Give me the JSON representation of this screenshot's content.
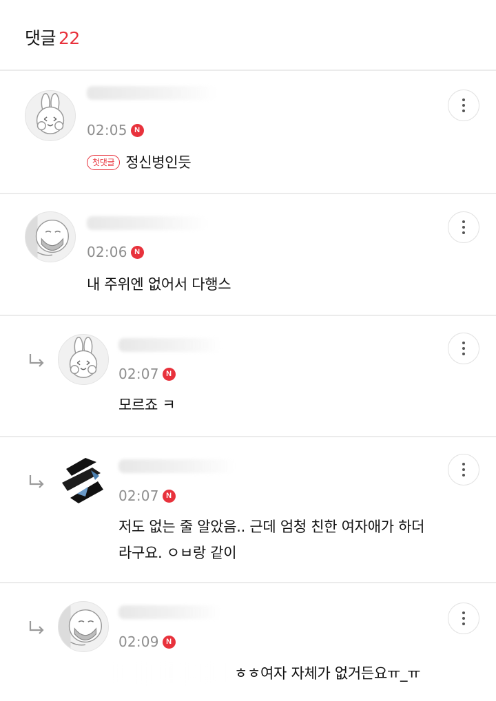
{
  "header": {
    "title": "댓글",
    "count": "22"
  },
  "icons": {
    "more": "more-vertical-icon",
    "reply": "reply-arrow-icon",
    "new": "new-badge-icon"
  },
  "colors": {
    "accent": "#e8323c",
    "muted": "#8e8e8e",
    "divider": "#ebebeb"
  },
  "comments": [
    {
      "time": "02:05",
      "new_badge": "N",
      "first_badge": "첫댓글",
      "text": "정신병인듯",
      "is_reply": false,
      "avatar": "bunny-avatar-icon"
    },
    {
      "time": "02:06",
      "new_badge": "N",
      "text": "내 주위엔 없어서 다행스",
      "is_reply": false,
      "avatar": "face-mask-avatar-icon"
    },
    {
      "time": "02:07",
      "new_badge": "N",
      "text": "모르죠 ㅋ",
      "is_reply": true,
      "avatar": "bunny-avatar-icon"
    },
    {
      "time": "02:07",
      "new_badge": "N",
      "text": "저도 없는 줄 알았음.. 근데 엄청 친한 여자애가 하더 라구요. ㅇㅂ랑 같이",
      "text_line1": "저도 없는 줄 알았음.. 근데 엄청 친한 여자애가 하더",
      "text_line2": "라구요. ㅇㅂ랑 같이",
      "is_reply": true,
      "avatar": "abstract-avatar-icon"
    },
    {
      "time": "02:09",
      "new_badge": "N",
      "text": "ㅎㅎ여자 자체가 없거든요ㅠ_ㅠ",
      "is_reply": true,
      "avatar": "face-mask-avatar-icon"
    }
  ]
}
